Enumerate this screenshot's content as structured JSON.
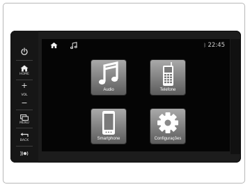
{
  "sidebar": {
    "power": {
      "icon": "power-icon"
    },
    "home": {
      "icon": "home-icon",
      "label": "HOME"
    },
    "volume": {
      "plus": "+",
      "label": "VOL",
      "minus": "−"
    },
    "menu": {
      "icon": "menu-icon",
      "label": "MENU"
    },
    "back": {
      "icon": "back-arrow-icon",
      "label": "BACK"
    },
    "settings": {
      "icon": "settings-knob-icon"
    }
  },
  "status_bar": {
    "home_icon": "home-icon",
    "music_icon": "music-note-icon",
    "bluetooth_icon": "bluetooth-icon",
    "time": "22:45"
  },
  "tiles": [
    {
      "label": "Audio",
      "icon": "music-note-icon"
    },
    {
      "label": "Telefone",
      "icon": "phone-icon"
    },
    {
      "label": "Smartphone",
      "icon": "smartphone-icon"
    },
    {
      "label": "Configurações",
      "icon": "gear-icon"
    }
  ],
  "colors": {
    "bezel": "#1c1c1c",
    "screen": "#050505",
    "tile_top": "#a9a9a9",
    "tile_bottom": "#5c5c5c",
    "text": "#ffffff"
  }
}
